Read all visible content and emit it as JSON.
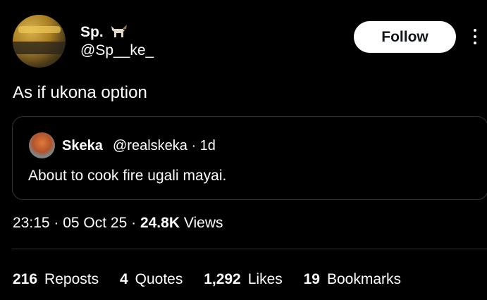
{
  "author": {
    "name": "Sp.",
    "handle": "@Sp__ke_",
    "name_emoji": "goat-icon"
  },
  "follow_label": "Follow",
  "tweet_text": "As if ukona option",
  "quoted": {
    "name": "Skeka",
    "handle": "@realskeka · 1d",
    "text": "About to cook fire ugali mayai."
  },
  "meta": {
    "time": "23:15 · 05 Oct 25 ·",
    "views_count": "24.8K",
    "views_label": "Views"
  },
  "stats": [
    {
      "count": "216",
      "label": "Reposts"
    },
    {
      "count": "4",
      "label": "Quotes"
    },
    {
      "count": "1,292",
      "label": "Likes"
    },
    {
      "count": "19",
      "label": "Bookmarks"
    }
  ],
  "colors": {
    "background": "#000000",
    "text": "#e7e9ea",
    "border": "#2f3336",
    "button_bg": "#ffffff"
  }
}
